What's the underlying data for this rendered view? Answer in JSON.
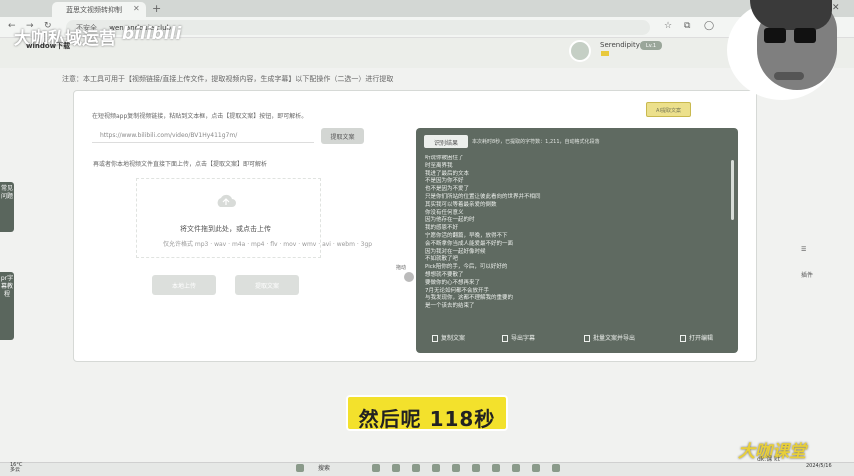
{
  "browser": {
    "tab_title": "蓝思文视频转抑制",
    "url_security": "不安全",
    "url": "wen.andouje.club"
  },
  "header": {
    "brand": "大咖私域运营",
    "brand_logo": "bilibili",
    "subtitle": "window下载",
    "user_name": "Serendipity",
    "user_badge": "Lv.1"
  },
  "notice": "注意：本工具可用于【视频链接/直接上传文件，提取视频内容，生成字幕】以下配操作（二选一）进行提取",
  "input_section": {
    "hint": "在短视频app复制视频链接，粘贴到文本框，点击【提取文案】按钮，即可解析。",
    "url_placeholder": "https://www.bilibili.com/video/BV1Hy411g7m/",
    "parse_button": "提取文案",
    "or_hint": "再或者你本地视频文件直接下面上传，点击【提取文案】即可解析",
    "upload_text": "将文件拖到此处，或点击上传",
    "upload_types": "仅允许格式 mp3 · wav · m4a · mp4 · flv · mov · wmv · avi · webm · 3gp",
    "btn_upload": "本地上传",
    "btn_extract": "提取文案",
    "ai_tag": "AI提取文案"
  },
  "result_panel": {
    "header_btn": "识别结果",
    "info": "本次耗时8秒，已提取的字符数：1,211，自动格式化段落",
    "lines": [
      "听说你被困住了",
      "时至离界我",
      "我进了最后的文本",
      "不是因为你不好",
      "也不是因为不爱了",
      "只是你们所站的位置让彼此看向的世界并不相同",
      "其实我可以等着最亲爱的倒数",
      "你没有任何意义",
      "因为他存在一起的时",
      "我的感恩不好",
      "宁愿你活的翻篇，早晚，放得不下",
      "会不断拿你当成人能爱最不好的一面",
      "因为我对在一起好像时候",
      "不如就散了吧",
      "Pick陪你的手，今后，可以好好的",
      "想想就不要散了",
      "要做你的心不想再来了",
      "7月无论如何都不会放开手",
      "与我发现你，这都不理解我的重要的",
      "是一个该去的结束了"
    ],
    "btn_copy": "复制文案",
    "btn_export": "导出字幕",
    "btn_batch": "批量文案并导出",
    "btn_edit": "打开编辑"
  },
  "side_left": [
    "常见问题",
    "pr字幕教程"
  ],
  "side_right": {
    "tools": "插件",
    "service": "客服"
  },
  "vector_label": "拖动",
  "subtitle_overlay": "然后呢 118秒",
  "taskbar": {
    "weather_temp": "16°C",
    "weather_desc": "多云",
    "search": "搜索",
    "clock": "2024/5/16"
  },
  "watermark": {
    "title": "大咖课堂",
    "sub": "dk.课 kt"
  }
}
